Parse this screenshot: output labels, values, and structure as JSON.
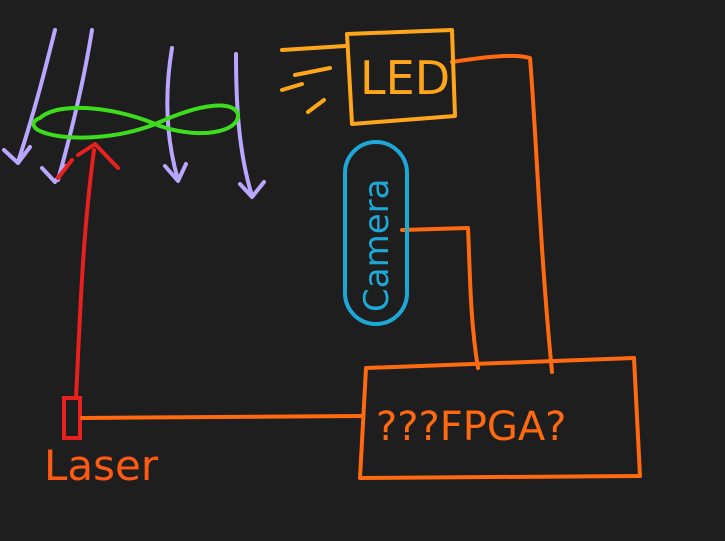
{
  "colors": {
    "background": "#1e1e1e",
    "airflow": "#b9a7ff",
    "propeller": "#3ddc1c",
    "laser_beam": "#e8201f",
    "laser_label": "#ff5a14",
    "wire": "#ff6a10",
    "led": "#ffa51a",
    "camera": "#1ea8d6",
    "fpga": "#ff6a10"
  },
  "labels": {
    "led": "LED",
    "camera": "Camera",
    "fpga": "???FPGA?",
    "laser": "Laser"
  },
  "icons": {
    "airflow": "down-arrow",
    "propeller": "propeller-blade",
    "laser": "laser-emitter"
  }
}
